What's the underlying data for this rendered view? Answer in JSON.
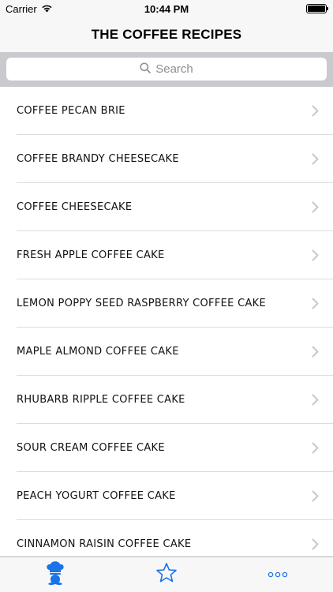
{
  "status_bar": {
    "carrier": "Carrier",
    "time": "10:44 PM",
    "wifi_icon": "wifi-icon",
    "battery_icon": "battery-icon"
  },
  "nav": {
    "title": "THE COFFEE RECIPES"
  },
  "search": {
    "placeholder": "Search",
    "icon": "search-icon"
  },
  "recipes": [
    "COFFEE PECAN BRIE",
    "COFFEE BRANDY CHEESECAKE",
    "COFFEE CHEESECAKE",
    "FRESH APPLE COFFEE CAKE",
    "LEMON POPPY SEED RASPBERRY COFFEE CAKE",
    "MAPLE ALMOND COFFEE CAKE",
    "RHUBARB RIPPLE COFFEE CAKE",
    "SOUR CREAM COFFEE CAKE",
    "PEACH YOGURT COFFEE CAKE",
    "CINNAMON RAISIN COFFEE CAKE"
  ],
  "tabs": [
    {
      "icon": "chef-icon",
      "active": true
    },
    {
      "icon": "star-icon",
      "active": false
    },
    {
      "icon": "more-icon",
      "active": false
    }
  ],
  "colors": {
    "accent": "#1a73e8",
    "chevron": "#c7c7cc",
    "separator": "#dcdcdc",
    "search_bar_bg": "#c9c9ce"
  }
}
